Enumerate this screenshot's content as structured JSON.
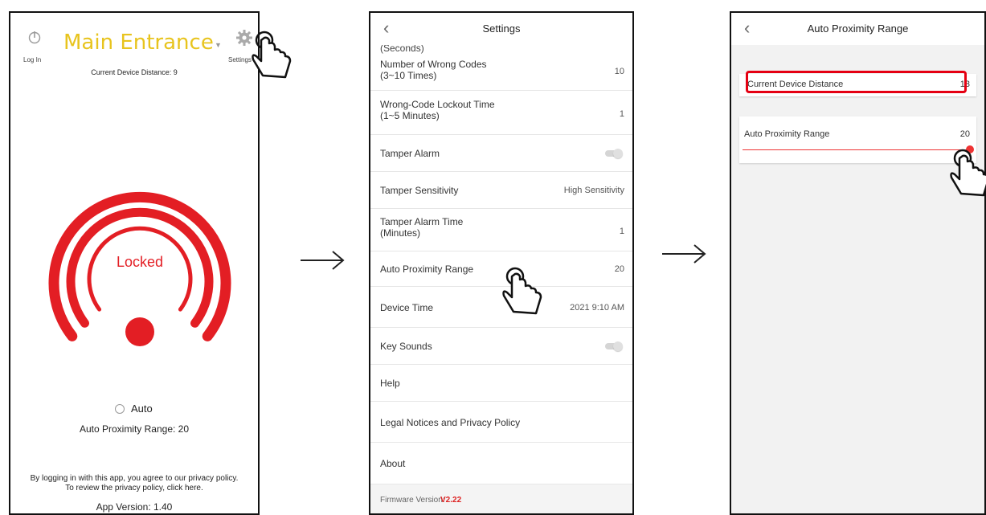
{
  "screen1": {
    "login_label": "Log In",
    "title": "Main Entrance",
    "settings_label": "Settings",
    "current_distance": "Current Device Distance: 9",
    "lock_status": "Locked",
    "auto_label": "Auto",
    "auto_range": "Auto Proximity Range: 20",
    "privacy_line1": "By logging in with this app, you agree to our privacy policy.",
    "privacy_line2": "To review the privacy policy, click here.",
    "app_version": "App Version: 1.40",
    "accent_color": "#e31e24",
    "title_color": "#e8c41e"
  },
  "screen2": {
    "title": "Settings",
    "cut_label": "(Seconds)",
    "rows": [
      {
        "label": "Number of Wrong Codes",
        "sub": "(3~10 Times)",
        "value": "10"
      },
      {
        "label": "Wrong-Code Lockout Time",
        "sub": "(1~5 Minutes)",
        "value": "1"
      },
      {
        "label": "Tamper Alarm",
        "toggle": "off"
      },
      {
        "label": "Tamper Sensitivity",
        "value": "High Sensitivity"
      },
      {
        "label": "Tamper Alarm Time",
        "sub": "(Minutes)",
        "value": "1"
      },
      {
        "label": "Auto Proximity Range",
        "value": "20"
      },
      {
        "label": "Device Time",
        "value": "2021 9:10 AM"
      },
      {
        "label": "Key Sounds",
        "toggle": "off"
      },
      {
        "label": "Help"
      },
      {
        "label": "Legal Notices and Privacy Policy"
      },
      {
        "label": "About"
      }
    ],
    "firmware_label": "Firmware Version:",
    "firmware_value": "V2.22"
  },
  "screen3": {
    "title": "Auto Proximity Range",
    "current_label": "Current Device Distance",
    "current_value": "13",
    "range_label": "Auto Proximity Range",
    "range_value": "20",
    "slider_level": 1.0,
    "highlight_color": "#e50012"
  }
}
